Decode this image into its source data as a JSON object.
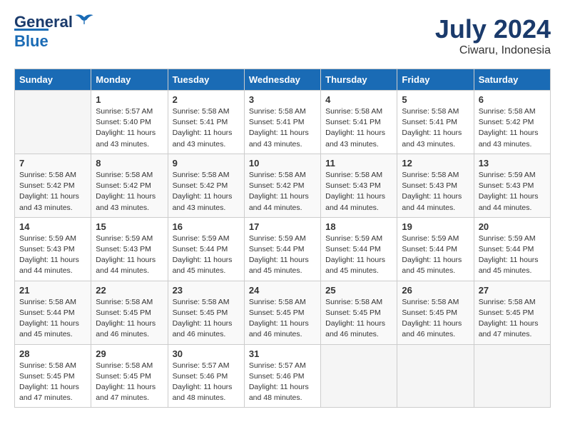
{
  "header": {
    "logo_line1": "General",
    "logo_line2": "Blue",
    "month": "July 2024",
    "location": "Ciwaru, Indonesia"
  },
  "columns": [
    "Sunday",
    "Monday",
    "Tuesday",
    "Wednesday",
    "Thursday",
    "Friday",
    "Saturday"
  ],
  "weeks": [
    [
      {
        "day": "",
        "info": ""
      },
      {
        "day": "1",
        "info": "Sunrise: 5:57 AM\nSunset: 5:40 PM\nDaylight: 11 hours\nand 43 minutes."
      },
      {
        "day": "2",
        "info": "Sunrise: 5:58 AM\nSunset: 5:41 PM\nDaylight: 11 hours\nand 43 minutes."
      },
      {
        "day": "3",
        "info": "Sunrise: 5:58 AM\nSunset: 5:41 PM\nDaylight: 11 hours\nand 43 minutes."
      },
      {
        "day": "4",
        "info": "Sunrise: 5:58 AM\nSunset: 5:41 PM\nDaylight: 11 hours\nand 43 minutes."
      },
      {
        "day": "5",
        "info": "Sunrise: 5:58 AM\nSunset: 5:41 PM\nDaylight: 11 hours\nand 43 minutes."
      },
      {
        "day": "6",
        "info": "Sunrise: 5:58 AM\nSunset: 5:42 PM\nDaylight: 11 hours\nand 43 minutes."
      }
    ],
    [
      {
        "day": "7",
        "info": "Sunrise: 5:58 AM\nSunset: 5:42 PM\nDaylight: 11 hours\nand 43 minutes."
      },
      {
        "day": "8",
        "info": "Sunrise: 5:58 AM\nSunset: 5:42 PM\nDaylight: 11 hours\nand 43 minutes."
      },
      {
        "day": "9",
        "info": "Sunrise: 5:58 AM\nSunset: 5:42 PM\nDaylight: 11 hours\nand 43 minutes."
      },
      {
        "day": "10",
        "info": "Sunrise: 5:58 AM\nSunset: 5:42 PM\nDaylight: 11 hours\nand 44 minutes."
      },
      {
        "day": "11",
        "info": "Sunrise: 5:58 AM\nSunset: 5:43 PM\nDaylight: 11 hours\nand 44 minutes."
      },
      {
        "day": "12",
        "info": "Sunrise: 5:58 AM\nSunset: 5:43 PM\nDaylight: 11 hours\nand 44 minutes."
      },
      {
        "day": "13",
        "info": "Sunrise: 5:59 AM\nSunset: 5:43 PM\nDaylight: 11 hours\nand 44 minutes."
      }
    ],
    [
      {
        "day": "14",
        "info": "Sunrise: 5:59 AM\nSunset: 5:43 PM\nDaylight: 11 hours\nand 44 minutes."
      },
      {
        "day": "15",
        "info": "Sunrise: 5:59 AM\nSunset: 5:43 PM\nDaylight: 11 hours\nand 44 minutes."
      },
      {
        "day": "16",
        "info": "Sunrise: 5:59 AM\nSunset: 5:44 PM\nDaylight: 11 hours\nand 45 minutes."
      },
      {
        "day": "17",
        "info": "Sunrise: 5:59 AM\nSunset: 5:44 PM\nDaylight: 11 hours\nand 45 minutes."
      },
      {
        "day": "18",
        "info": "Sunrise: 5:59 AM\nSunset: 5:44 PM\nDaylight: 11 hours\nand 45 minutes."
      },
      {
        "day": "19",
        "info": "Sunrise: 5:59 AM\nSunset: 5:44 PM\nDaylight: 11 hours\nand 45 minutes."
      },
      {
        "day": "20",
        "info": "Sunrise: 5:59 AM\nSunset: 5:44 PM\nDaylight: 11 hours\nand 45 minutes."
      }
    ],
    [
      {
        "day": "21",
        "info": "Sunrise: 5:58 AM\nSunset: 5:44 PM\nDaylight: 11 hours\nand 45 minutes."
      },
      {
        "day": "22",
        "info": "Sunrise: 5:58 AM\nSunset: 5:45 PM\nDaylight: 11 hours\nand 46 minutes."
      },
      {
        "day": "23",
        "info": "Sunrise: 5:58 AM\nSunset: 5:45 PM\nDaylight: 11 hours\nand 46 minutes."
      },
      {
        "day": "24",
        "info": "Sunrise: 5:58 AM\nSunset: 5:45 PM\nDaylight: 11 hours\nand 46 minutes."
      },
      {
        "day": "25",
        "info": "Sunrise: 5:58 AM\nSunset: 5:45 PM\nDaylight: 11 hours\nand 46 minutes."
      },
      {
        "day": "26",
        "info": "Sunrise: 5:58 AM\nSunset: 5:45 PM\nDaylight: 11 hours\nand 46 minutes."
      },
      {
        "day": "27",
        "info": "Sunrise: 5:58 AM\nSunset: 5:45 PM\nDaylight: 11 hours\nand 47 minutes."
      }
    ],
    [
      {
        "day": "28",
        "info": "Sunrise: 5:58 AM\nSunset: 5:45 PM\nDaylight: 11 hours\nand 47 minutes."
      },
      {
        "day": "29",
        "info": "Sunrise: 5:58 AM\nSunset: 5:45 PM\nDaylight: 11 hours\nand 47 minutes."
      },
      {
        "day": "30",
        "info": "Sunrise: 5:57 AM\nSunset: 5:46 PM\nDaylight: 11 hours\nand 48 minutes."
      },
      {
        "day": "31",
        "info": "Sunrise: 5:57 AM\nSunset: 5:46 PM\nDaylight: 11 hours\nand 48 minutes."
      },
      {
        "day": "",
        "info": ""
      },
      {
        "day": "",
        "info": ""
      },
      {
        "day": "",
        "info": ""
      }
    ]
  ]
}
